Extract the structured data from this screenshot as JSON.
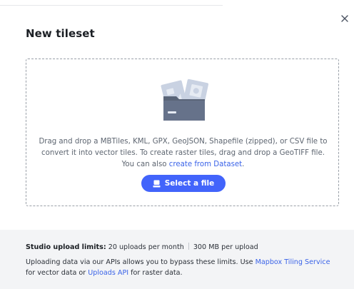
{
  "modal": {
    "title": "New tileset",
    "close_icon": "close-icon"
  },
  "dropzone": {
    "illustration_icon": "files-folder-icon",
    "text_before_link": "Drag and drop a MBTiles, KML, GPX, GeoJSON, Shapefile (zipped), or CSV file to convert it into vector tiles. To create raster tiles, drag and drop a GeoTIFF file. You can also ",
    "link_label": "create from Dataset",
    "text_after_link": ".",
    "button_label": "Select a file",
    "button_icon": "upload-icon"
  },
  "footer": {
    "limits_heading": "Studio upload limits:",
    "limit_uploads": " 20 uploads per month",
    "limit_size": "300 MB per upload",
    "bypass_text_1": "Uploading data via our APIs allows you to bypass these limits. Use ",
    "link_tiling_service": "Mapbox Tiling Service",
    "bypass_text_2": " for vector data or ",
    "link_uploads_api": "Uploads API",
    "bypass_text_3": " for raster data."
  },
  "colors": {
    "accent": "#4264fb",
    "link": "#3a63e8",
    "footer_bg": "#f3f4f6",
    "folder": "#5a6578"
  }
}
